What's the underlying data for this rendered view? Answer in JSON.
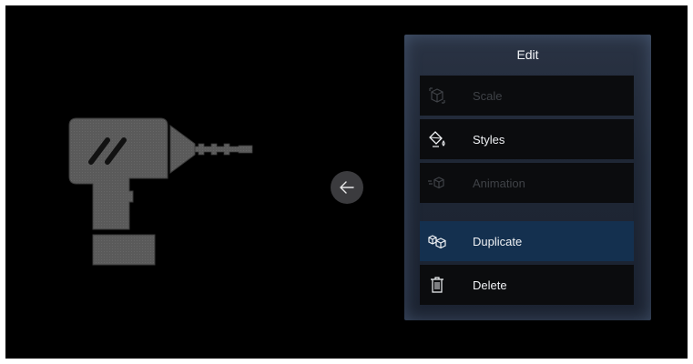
{
  "panel": {
    "title": "Edit",
    "items": [
      {
        "label": "Scale",
        "icon": "cube-scale-icon",
        "enabled": false
      },
      {
        "label": "Styles",
        "icon": "paint-bucket-icon",
        "enabled": true
      },
      {
        "label": "Animation",
        "icon": "animation-icon",
        "enabled": false
      },
      {
        "label": "Duplicate",
        "icon": "duplicate-cubes-icon",
        "enabled": true,
        "selected": true
      },
      {
        "label": "Delete",
        "icon": "trash-icon",
        "enabled": true
      }
    ]
  },
  "back_button": {
    "icon": "arrow-left-icon"
  },
  "scene": {
    "object": "drill-model"
  }
}
